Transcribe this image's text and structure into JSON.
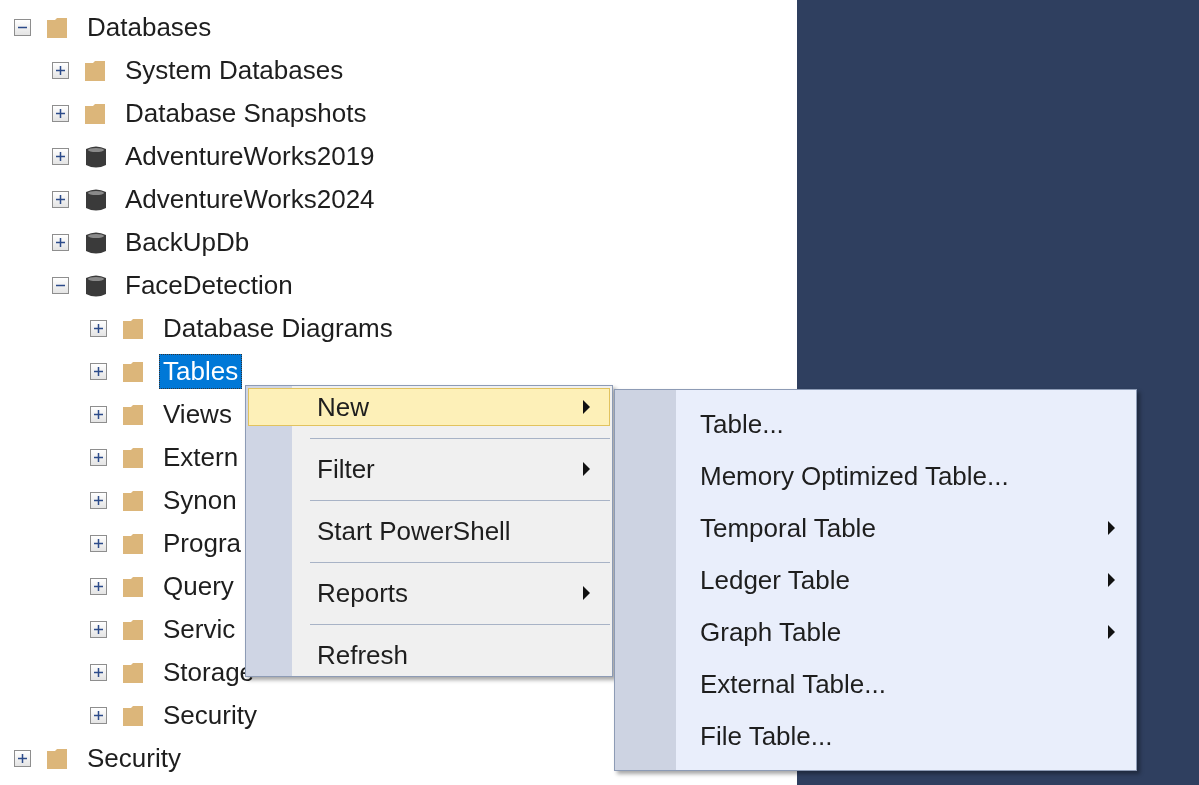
{
  "tree": [
    {
      "label": "Databases",
      "kind": "folder",
      "expanded": true,
      "selected": false,
      "children": [
        {
          "label": "System Databases",
          "kind": "folder",
          "expanded": false,
          "selected": false
        },
        {
          "label": "Database Snapshots",
          "kind": "folder",
          "expanded": false,
          "selected": false
        },
        {
          "label": "AdventureWorks2019",
          "kind": "database",
          "expanded": false,
          "selected": false
        },
        {
          "label": "AdventureWorks2024",
          "kind": "database",
          "expanded": false,
          "selected": false
        },
        {
          "label": "BackUpDb",
          "kind": "database",
          "expanded": false,
          "selected": false
        },
        {
          "label": "FaceDetection",
          "kind": "database",
          "expanded": true,
          "selected": false,
          "children": [
            {
              "label": "Database Diagrams",
              "kind": "folder",
              "expanded": false,
              "selected": false
            },
            {
              "label": "Tables",
              "kind": "folder",
              "expanded": false,
              "selected": true
            },
            {
              "label": "Views",
              "kind": "folder",
              "expanded": false,
              "selected": false
            },
            {
              "label": "Extern",
              "kind": "folder",
              "expanded": false,
              "selected": false
            },
            {
              "label": "Synon",
              "kind": "folder",
              "expanded": false,
              "selected": false
            },
            {
              "label": "Progra",
              "kind": "folder",
              "expanded": false,
              "selected": false
            },
            {
              "label": "Query",
              "kind": "folder",
              "expanded": false,
              "selected": false
            },
            {
              "label": "Servic",
              "kind": "folder",
              "expanded": false,
              "selected": false
            },
            {
              "label": "Storage",
              "kind": "folder",
              "expanded": false,
              "selected": false
            },
            {
              "label": "Security",
              "kind": "folder",
              "expanded": false,
              "selected": false
            }
          ]
        }
      ]
    },
    {
      "label": "Security",
      "kind": "folder",
      "expanded": false,
      "selected": false
    }
  ],
  "context_menu": {
    "items": [
      {
        "label": "New",
        "has_submenu": true,
        "selected": true
      },
      {
        "label": "Filter",
        "has_submenu": true,
        "selected": false
      },
      {
        "label": "Start PowerShell",
        "has_submenu": false,
        "selected": false
      },
      {
        "label": "Reports",
        "has_submenu": true,
        "selected": false
      },
      {
        "label": "Refresh",
        "has_submenu": false,
        "selected": false
      }
    ]
  },
  "submenu": {
    "items": [
      {
        "label": "Table...",
        "has_submenu": false
      },
      {
        "label": "Memory Optimized Table...",
        "has_submenu": false
      },
      {
        "label": "Temporal Table",
        "has_submenu": true
      },
      {
        "label": "Ledger Table",
        "has_submenu": true
      },
      {
        "label": "Graph Table",
        "has_submenu": true
      },
      {
        "label": "External Table...",
        "has_submenu": false
      },
      {
        "label": "File Table...",
        "has_submenu": false
      }
    ]
  }
}
